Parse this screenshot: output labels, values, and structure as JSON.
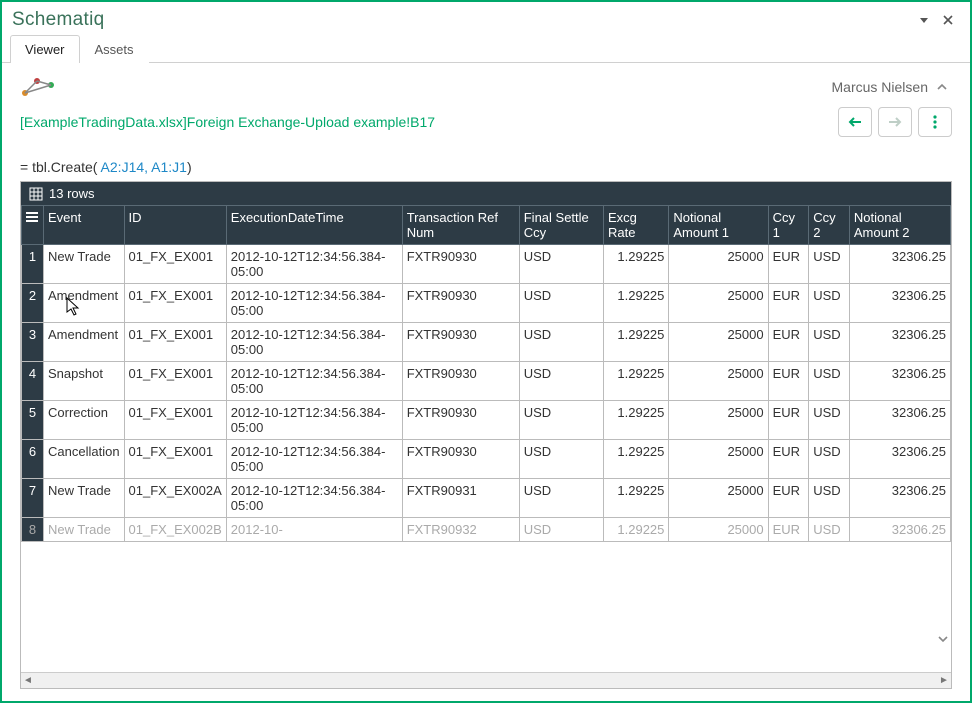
{
  "window": {
    "title": "Schematiq"
  },
  "tabs": [
    {
      "label": "Viewer",
      "active": true
    },
    {
      "label": "Assets",
      "active": false
    }
  ],
  "user": {
    "name": "Marcus Nielsen"
  },
  "breadcrumb": "[ExampleTradingData.xlsx]Foreign Exchange-Upload example!B17",
  "formula": {
    "prefix": "= ",
    "fn": "tbl.Create(",
    "args": " A2:J14, A1:J1",
    "suffix": ")"
  },
  "table": {
    "row_count_label": "13 rows",
    "columns": [
      "Event",
      "ID",
      "ExecutionDateTime",
      "Transaction Ref Num",
      "Final Settle Ccy",
      "Excg Rate",
      "Notional Amount 1",
      "Ccy 1",
      "Ccy 2",
      "Notional Amount 2"
    ],
    "rows": [
      {
        "n": "1",
        "event": "New Trade",
        "id": "01_FX_EX001",
        "dt": "2012-10-12T12:34:56.384-05:00",
        "ref": "FXTR90930",
        "ccy": "USD",
        "rate": "1.29225",
        "amt1": "25000",
        "ccy1": "EUR",
        "ccy2": "USD",
        "amt2": "32306.25"
      },
      {
        "n": "2",
        "event": "Amendment",
        "id": "01_FX_EX001",
        "dt": "2012-10-12T12:34:56.384-05:00",
        "ref": "FXTR90930",
        "ccy": "USD",
        "rate": "1.29225",
        "amt1": "25000",
        "ccy1": "EUR",
        "ccy2": "USD",
        "amt2": "32306.25"
      },
      {
        "n": "3",
        "event": "Amendment",
        "id": "01_FX_EX001",
        "dt": "2012-10-12T12:34:56.384-05:00",
        "ref": "FXTR90930",
        "ccy": "USD",
        "rate": "1.29225",
        "amt1": "25000",
        "ccy1": "EUR",
        "ccy2": "USD",
        "amt2": "32306.25"
      },
      {
        "n": "4",
        "event": "Snapshot",
        "id": "01_FX_EX001",
        "dt": "2012-10-12T12:34:56.384-05:00",
        "ref": "FXTR90930",
        "ccy": "USD",
        "rate": "1.29225",
        "amt1": "25000",
        "ccy1": "EUR",
        "ccy2": "USD",
        "amt2": "32306.25"
      },
      {
        "n": "5",
        "event": "Correction",
        "id": "01_FX_EX001",
        "dt": "2012-10-12T12:34:56.384-05:00",
        "ref": "FXTR90930",
        "ccy": "USD",
        "rate": "1.29225",
        "amt1": "25000",
        "ccy1": "EUR",
        "ccy2": "USD",
        "amt2": "32306.25"
      },
      {
        "n": "6",
        "event": "Cancellation",
        "id": "01_FX_EX001",
        "dt": "2012-10-12T12:34:56.384-05:00",
        "ref": "FXTR90930",
        "ccy": "USD",
        "rate": "1.29225",
        "amt1": "25000",
        "ccy1": "EUR",
        "ccy2": "USD",
        "amt2": "32306.25"
      },
      {
        "n": "7",
        "event": "New Trade",
        "id": "01_FX_EX002A",
        "dt": "2012-10-12T12:34:56.384-05:00",
        "ref": "FXTR90931",
        "ccy": "USD",
        "rate": "1.29225",
        "amt1": "25000",
        "ccy1": "EUR",
        "ccy2": "USD",
        "amt2": "32306.25"
      },
      {
        "n": "8",
        "event": "New Trade",
        "id": "01_FX_EX002B",
        "dt": "2012-10-",
        "ref": "FXTR90932",
        "ccy": "USD",
        "rate": "1.29225",
        "amt1": "25000",
        "ccy1": "EUR",
        "ccy2": "USD",
        "amt2": "32306.25",
        "faded": true
      }
    ]
  }
}
